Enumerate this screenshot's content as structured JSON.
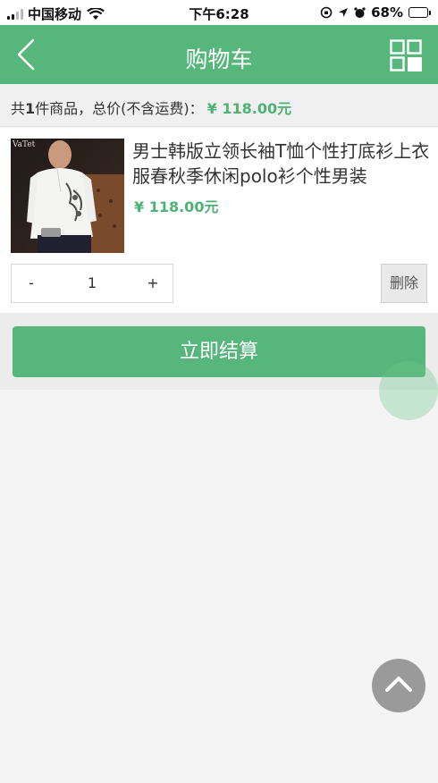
{
  "status": {
    "carrier": "中国移动",
    "time": "下午6:28",
    "battery_pct": "68%",
    "battery_level": 0.68
  },
  "nav": {
    "title": "购物车",
    "back_icon": "chevron-left-icon",
    "right_icon": "qr-grid-icon"
  },
  "summary": {
    "prefix": "共",
    "count": "1",
    "middle": "件商品，总价(不含运费)：",
    "total": "¥ 118.00元"
  },
  "cart": {
    "items": [
      {
        "name": "男士韩版立领长袖T恤个性打底衫上衣服春秋季休闲polo衫个性男装",
        "price": "¥ 118.00元",
        "quantity": "1",
        "image_text": "VaTet"
      }
    ],
    "minus_label": "-",
    "plus_label": "+",
    "delete_label": "删除"
  },
  "checkout": {
    "label": "立即结算"
  },
  "colors": {
    "brand": "#56b67c",
    "price": "#4fb275"
  }
}
